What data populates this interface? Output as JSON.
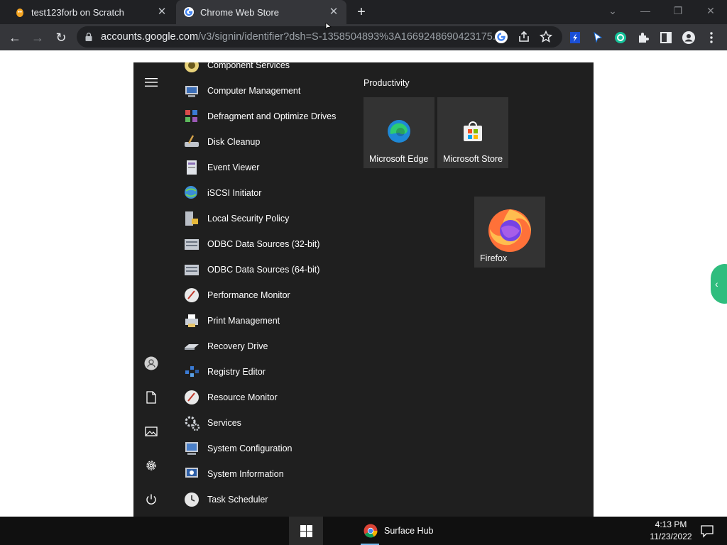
{
  "browser": {
    "tabs": [
      {
        "title": "test123forb on Scratch",
        "icon": "scratch-cat-icon",
        "active": false
      },
      {
        "title": "Chrome Web Store",
        "icon": "google-icon",
        "active": true
      }
    ],
    "url_host": "accounts.google.com",
    "url_path": "/v3/signin/identifier?dsh=S-1358504893%3A1669248690423175..."
  },
  "start_menu": {
    "apps": [
      {
        "name": "Component Services",
        "icon": "component-services-icon"
      },
      {
        "name": "Computer Management",
        "icon": "computer-management-icon"
      },
      {
        "name": "Defragment and Optimize Drives",
        "icon": "defrag-icon"
      },
      {
        "name": "Disk Cleanup",
        "icon": "disk-cleanup-icon"
      },
      {
        "name": "Event Viewer",
        "icon": "event-viewer-icon"
      },
      {
        "name": "iSCSI Initiator",
        "icon": "iscsi-icon"
      },
      {
        "name": "Local Security Policy",
        "icon": "security-policy-icon"
      },
      {
        "name": "ODBC Data Sources (32-bit)",
        "icon": "odbc-icon"
      },
      {
        "name": "ODBC Data Sources (64-bit)",
        "icon": "odbc-icon"
      },
      {
        "name": "Performance Monitor",
        "icon": "performance-monitor-icon"
      },
      {
        "name": "Print Management",
        "icon": "print-management-icon"
      },
      {
        "name": "Recovery Drive",
        "icon": "recovery-drive-icon"
      },
      {
        "name": "Registry Editor",
        "icon": "registry-editor-icon"
      },
      {
        "name": "Resource Monitor",
        "icon": "resource-monitor-icon"
      },
      {
        "name": "Services",
        "icon": "services-gear-icon"
      },
      {
        "name": "System Configuration",
        "icon": "system-configuration-icon"
      },
      {
        "name": "System Information",
        "icon": "system-information-icon"
      },
      {
        "name": "Task Scheduler",
        "icon": "task-scheduler-icon"
      }
    ],
    "group_title": "Productivity",
    "tiles": [
      {
        "label": "Microsoft Edge",
        "icon": "edge-icon"
      },
      {
        "label": "Microsoft Store",
        "icon": "store-icon"
      },
      {
        "label": "Firefox",
        "icon": "firefox-icon"
      }
    ],
    "rail_icons": [
      "hamburger-menu-icon",
      "user-icon",
      "documents-icon",
      "pictures-icon",
      "settings-icon",
      "power-icon"
    ]
  },
  "taskbar": {
    "app_label": "Surface Hub",
    "time": "4:13 PM",
    "date": "11/23/2022"
  },
  "colors": {
    "menu_bg": "#1f1f1f",
    "tile_bg": "#333333",
    "taskbar_bg": "#101010",
    "accent_green": "#2fbd7e"
  }
}
